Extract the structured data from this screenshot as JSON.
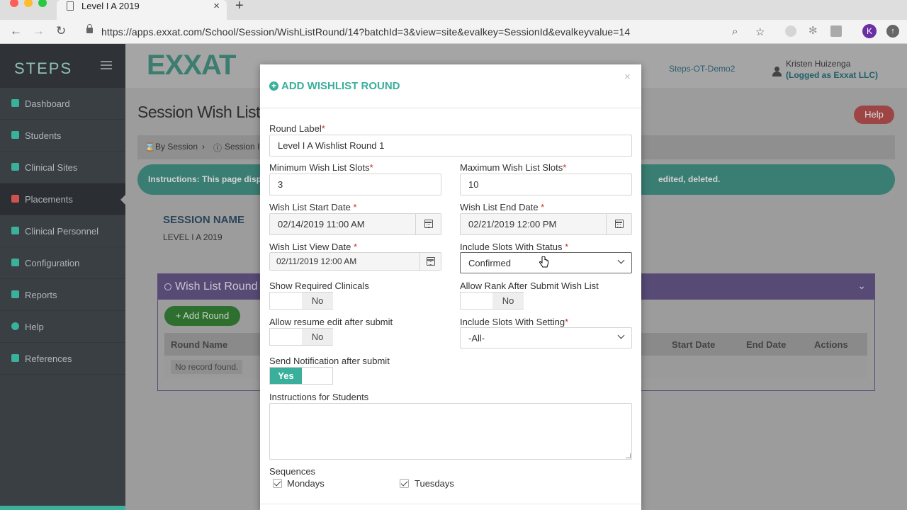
{
  "browser": {
    "tab_title": "Level I A 2019",
    "new_tab": "+",
    "tab_close": "×",
    "url": "https://apps.exxat.com/School/Session/WishListRound/14?batchId=3&view=site&evalkey=SessionId&evalkeyvalue=14",
    "profile_initial": "K"
  },
  "sidebar": {
    "brand": "STEPS",
    "items": [
      {
        "label": "Dashboard",
        "icon": "home-icon"
      },
      {
        "label": "Students",
        "icon": "user-icon"
      },
      {
        "label": "Clinical Sites",
        "icon": "building-icon"
      },
      {
        "label": "Placements",
        "icon": "placement-icon"
      },
      {
        "label": "Clinical Personnel",
        "icon": "user-icon"
      },
      {
        "label": "Configuration",
        "icon": "gear-icon"
      },
      {
        "label": "Reports",
        "icon": "bar-chart-icon"
      },
      {
        "label": "Help",
        "icon": "help-icon"
      },
      {
        "label": "References",
        "icon": "check-icon"
      }
    ]
  },
  "header": {
    "logo": "EXXAT",
    "account_link": "Steps-OT-Demo2",
    "user_name": "Kristen Huizenga",
    "user_sub": "(Logged as Exxat LLC)"
  },
  "page": {
    "title": "Session Wish List R",
    "help": "Help",
    "breadcrumb": [
      "By Session",
      "Session I"
    ],
    "instructions_left": "Instructions: This page displa",
    "instructions_right": "edited, deleted.",
    "session_name_label": "SESSION NAME",
    "session_name_value": "LEVEL I A 2019",
    "wish_panel_title": "Wish List Round",
    "add_round": "Add Round",
    "columns": {
      "round_name": "Round Name",
      "start_date": "Start Date",
      "end_date": "End Date",
      "actions": "Actions"
    },
    "no_record": "No record found."
  },
  "modal": {
    "title": "ADD WISHLIST ROUND",
    "close": "×",
    "round_label": {
      "label": "Round Label",
      "value": "Level I A Wishlist Round 1"
    },
    "min_slots": {
      "label": "Minimum Wish List Slots",
      "value": "3"
    },
    "max_slots": {
      "label": "Maximum Wish List Slots",
      "value": "10"
    },
    "start_date": {
      "label": "Wish List Start Date ",
      "value": "02/14/2019 11:00 AM"
    },
    "end_date": {
      "label": "Wish List End Date ",
      "value": "02/21/2019 12:00 PM"
    },
    "view_date": {
      "label": "Wish List View Date ",
      "value": "02/11/2019 12:00 AM"
    },
    "slots_status": {
      "label": "Include Slots With Status ",
      "value": "Confirmed"
    },
    "show_required": {
      "label": "Show Required Clinicals",
      "value": "No"
    },
    "allow_rank": {
      "label": "Allow Rank After Submit Wish List",
      "value": "No"
    },
    "allow_resume": {
      "label": "Allow resume edit after submit",
      "value": "No"
    },
    "slots_setting": {
      "label": "Include Slots With Setting",
      "value": "-All-"
    },
    "send_notification": {
      "label": "Send Notification after submit",
      "value": "Yes"
    },
    "instructions": {
      "label": "Instructions for Students",
      "value": ""
    },
    "sequences": {
      "label": "Sequences",
      "items": [
        "Mondays",
        "Tuesdays"
      ]
    },
    "required_mark": "*"
  }
}
